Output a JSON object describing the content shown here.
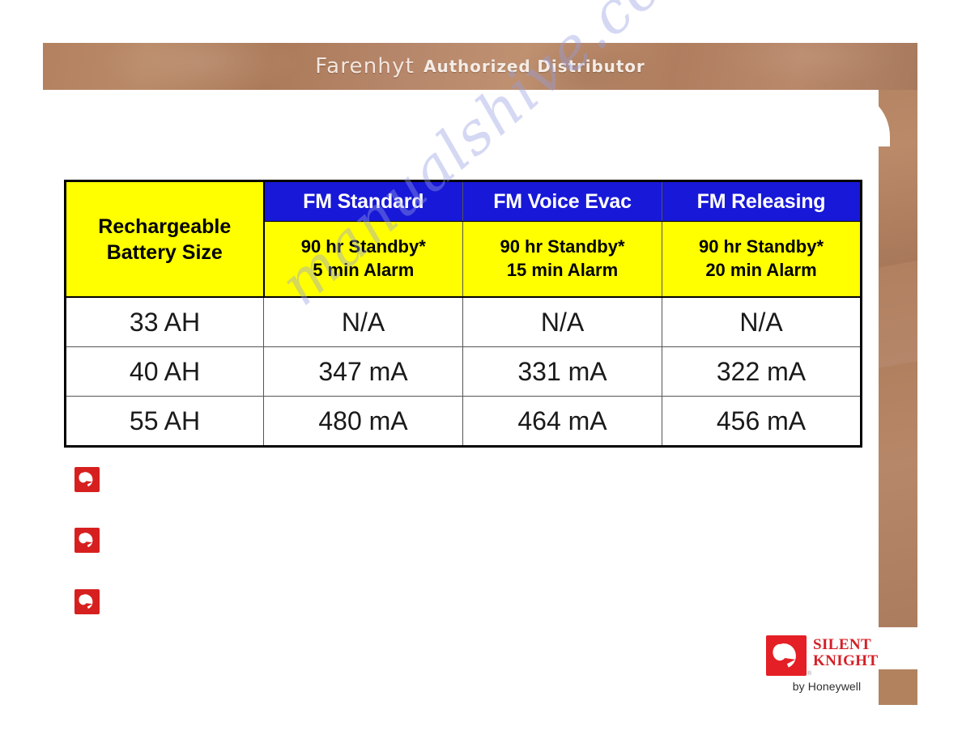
{
  "header": {
    "title_main": "Farenhyt",
    "title_sub": "Authorized Distributor"
  },
  "watermark": {
    "text": "manualshive.com"
  },
  "table": {
    "row_header_label": "Rechargeable\nBattery Size",
    "row_header_line1": "Rechargeable",
    "row_header_line2": "Battery Size",
    "columns": [
      {
        "title": "FM Standard",
        "sub_line1": "90 hr Standby*",
        "sub_line2": "5 min Alarm"
      },
      {
        "title": "FM Voice Evac",
        "sub_line1": "90 hr Standby*",
        "sub_line2": "15 min Alarm"
      },
      {
        "title": "FM Releasing",
        "sub_line1": "90 hr Standby*",
        "sub_line2": "20 min Alarm"
      }
    ],
    "rows": [
      {
        "label": "33 AH",
        "values": [
          "N/A",
          "N/A",
          "N/A"
        ]
      },
      {
        "label": "40 AH",
        "values": [
          "347 mA",
          "331 mA",
          "322 mA"
        ]
      },
      {
        "label": "55 AH",
        "values": [
          "480 mA",
          "464 mA",
          "456 mA"
        ]
      }
    ]
  },
  "bullets": [
    {
      "icon": "silent-knight-helmet-icon"
    },
    {
      "icon": "silent-knight-helmet-icon"
    },
    {
      "icon": "silent-knight-helmet-icon"
    }
  ],
  "logo": {
    "line1": "SILENT",
    "line2": "KNIGHT",
    "registered": "®",
    "byline": "by Honeywell"
  },
  "colors": {
    "brand_brown": "#b2825f",
    "header_blue": "#1818d8",
    "header_yellow": "#ffff00",
    "logo_red": "#e41f25",
    "bullet_red": "#d6201f",
    "watermark": "#969ee1"
  }
}
